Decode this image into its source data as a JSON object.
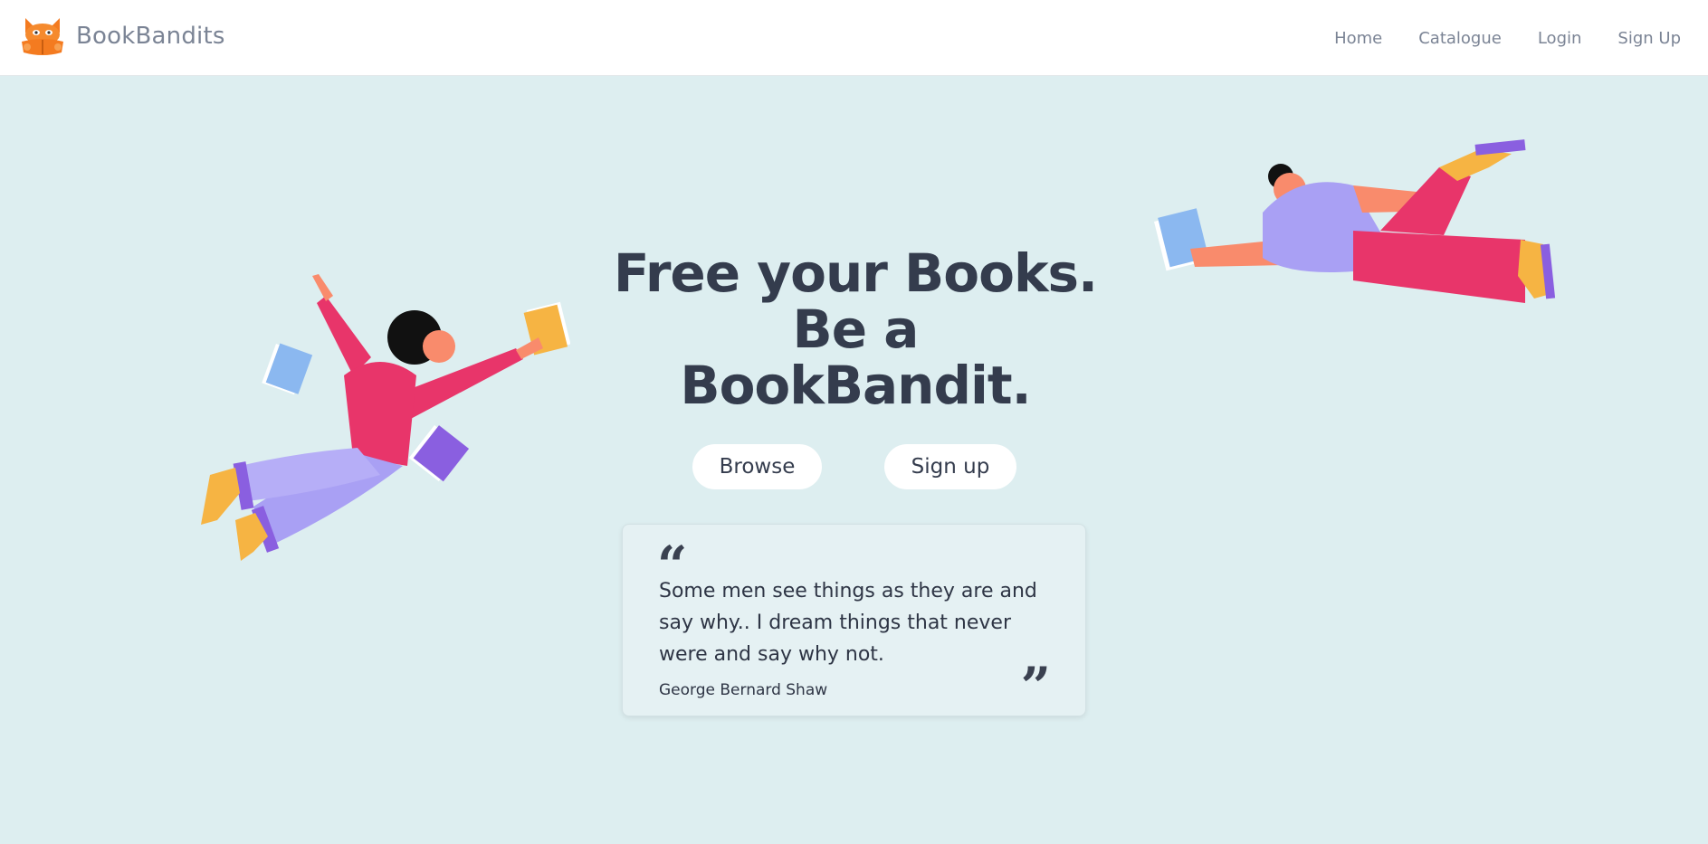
{
  "brand": {
    "name": "BookBandits",
    "logo_icon": "fox-reading-icon"
  },
  "nav": {
    "links": [
      {
        "label": "Home"
      },
      {
        "label": "Catalogue"
      },
      {
        "label": "Login"
      },
      {
        "label": "Sign Up"
      }
    ]
  },
  "hero": {
    "headline": [
      "Free your Books.",
      "Be a",
      "BookBandit."
    ],
    "buttons": {
      "browse": "Browse",
      "signup": "Sign up"
    },
    "quote": {
      "text": "Some men see things as they are and say why.. I dream things that never were and say why not.",
      "author": "George Bernard Shaw",
      "open_mark": "“",
      "close_mark": "”"
    }
  },
  "colors": {
    "background": "#ddeef0",
    "nav_bg": "#ffffff",
    "headline": "#343c4d",
    "brand_orange": "#f47b20"
  }
}
